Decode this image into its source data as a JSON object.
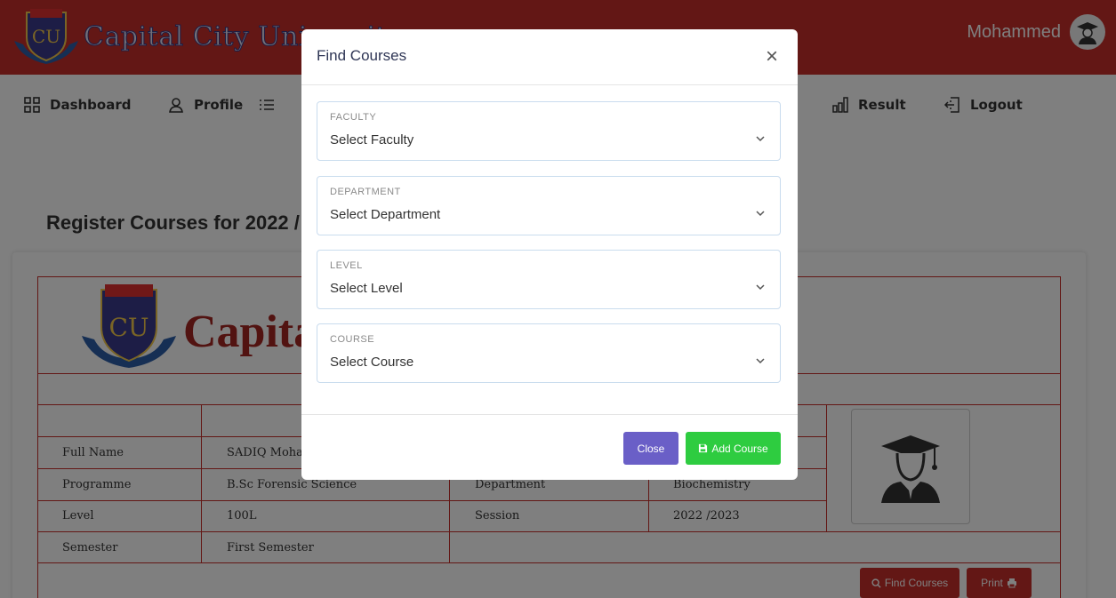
{
  "header": {
    "brand_name": "Capital City University",
    "user_name": "Mohammed"
  },
  "nav": {
    "items": [
      {
        "label": "Dashboard",
        "icon": "grid-icon"
      },
      {
        "label": "Profile",
        "icon": "user-icon"
      },
      {
        "label": "",
        "icon": "list-icon"
      },
      {
        "label": "Result",
        "icon": "bar-chart-icon"
      },
      {
        "label": "Logout",
        "icon": "logout-icon"
      }
    ]
  },
  "page": {
    "heading": "Register Courses for 2022 /"
  },
  "slip": {
    "school_name": "Capita",
    "rows": [
      {
        "label": "Full Name",
        "value": "SADIQ Moha",
        "label2": "",
        "value2": ""
      },
      {
        "label": "Programme",
        "value": "B.Sc Forensic Science",
        "label2": "Department",
        "value2": "Biochemistry"
      },
      {
        "label": "Level",
        "value": "100L",
        "label2": "Session",
        "value2": "2022 /2023"
      },
      {
        "label": "Semester",
        "value": "First Semester",
        "label2": "",
        "value2": ""
      }
    ],
    "find_courses_label": "Find Courses",
    "print_label": "Print"
  },
  "modal": {
    "title": "Find Courses",
    "fields": [
      {
        "label": "FACULTY",
        "value": "Select Faculty"
      },
      {
        "label": "DEPARTMENT",
        "value": "Select Department"
      },
      {
        "label": "LEVEL",
        "value": "Select Level"
      },
      {
        "label": "COURSE",
        "value": "Select Course"
      }
    ],
    "close_label": "Close",
    "add_label": "Add Course"
  },
  "colors": {
    "brand_red": "#c62e2a",
    "close_button": "#6a5fc7",
    "add_button": "#2ecc40"
  }
}
